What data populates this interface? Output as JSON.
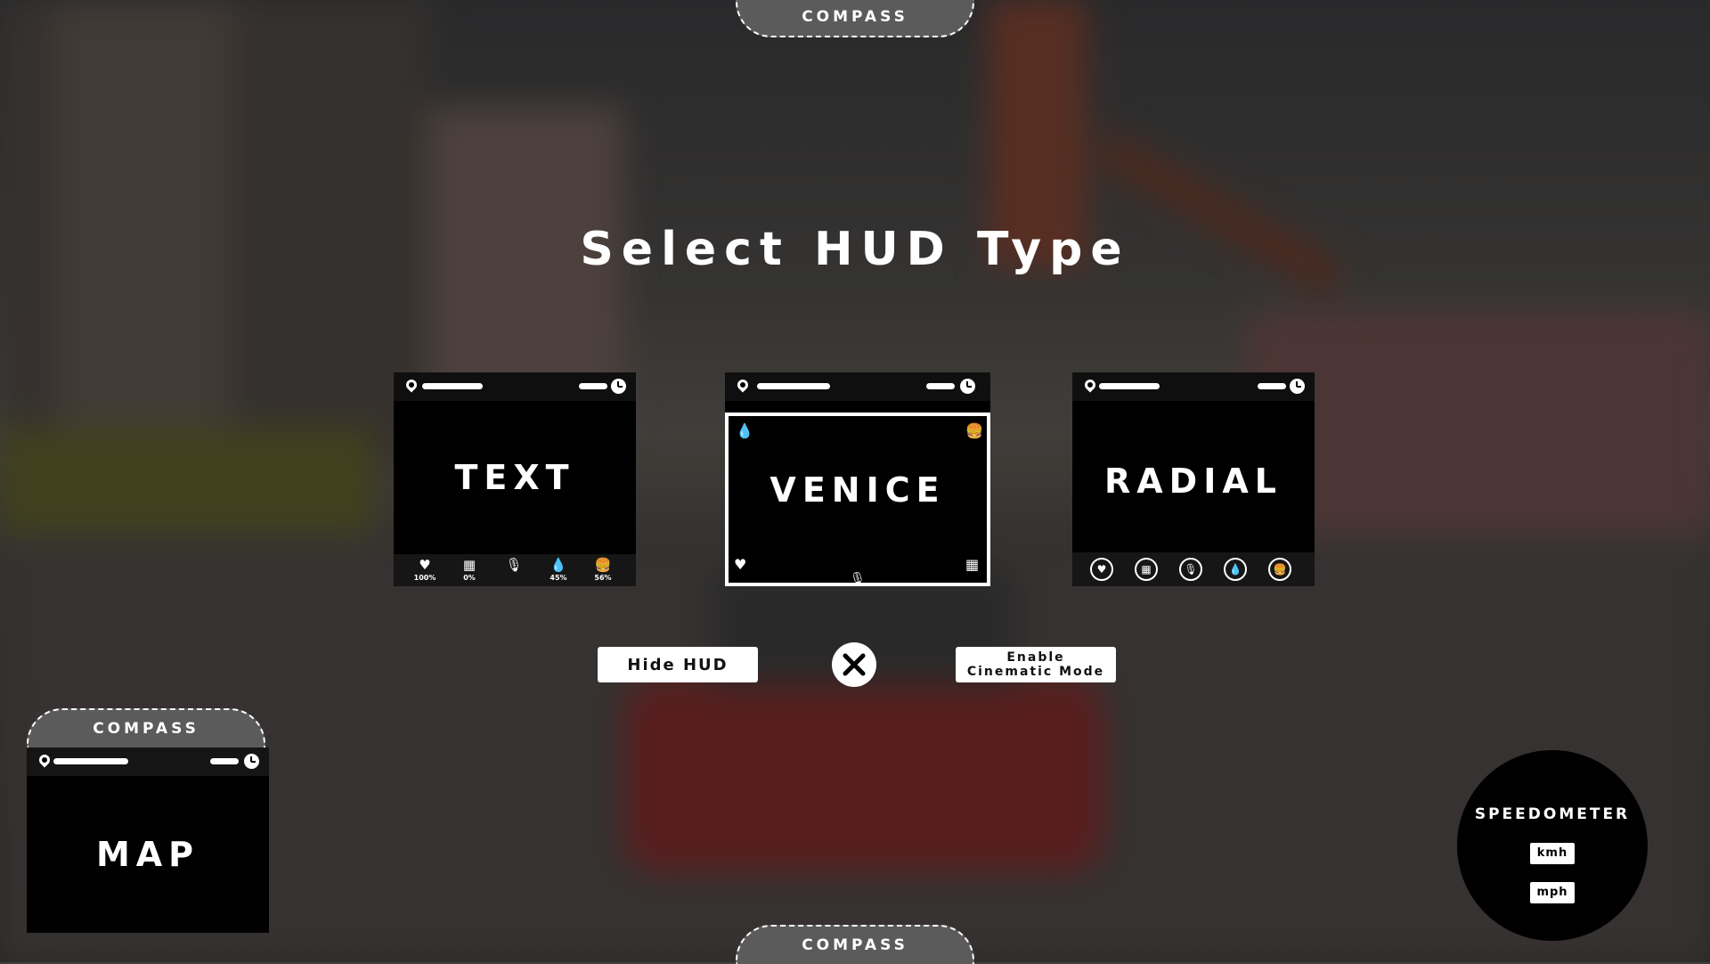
{
  "title": "Select HUD Type",
  "compass_label": "COMPASS",
  "hud_types": {
    "text": {
      "label": "TEXT",
      "stats": [
        {
          "icon": "heart-icon",
          "value": "100%"
        },
        {
          "icon": "armor-icon",
          "value": "0%"
        },
        {
          "icon": "microphone-icon",
          "value": ""
        },
        {
          "icon": "water-icon",
          "value": "45%"
        },
        {
          "icon": "food-icon",
          "value": "56%"
        }
      ]
    },
    "venice": {
      "label": "VENICE"
    },
    "radial": {
      "label": "RADIAL"
    }
  },
  "map": {
    "label": "MAP",
    "compass": "COMPASS"
  },
  "buttons": {
    "hide_hud": "Hide HUD",
    "cinematic_line1": "Enable",
    "cinematic_line2": "Cinematic Mode"
  },
  "speedometer": {
    "title": "SPEEDOMETER",
    "unit_kmh": "kmh",
    "unit_mph": "mph"
  },
  "colors": {
    "card_bg": "#000000",
    "button_bg": "#ffffff",
    "compass_bg": "#5b5b5b"
  }
}
